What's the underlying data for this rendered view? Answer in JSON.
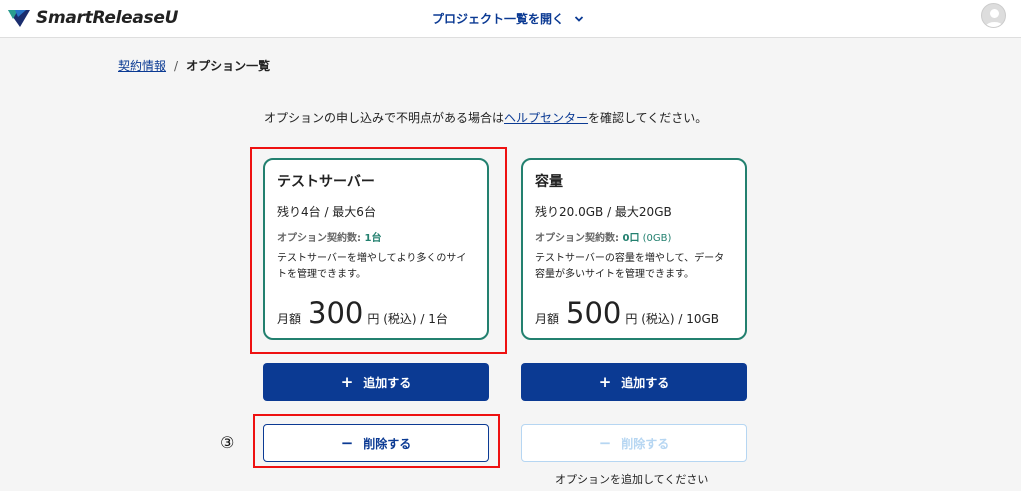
{
  "header": {
    "logo_text": "SmartReleaseU",
    "project_menu": "プロジェクト一覧を開く"
  },
  "breadcrumb": {
    "parent": "契約情報",
    "separator": "/",
    "current": "オプション一覧"
  },
  "notice": {
    "before": "オプションの申し込みで不明点がある場合は",
    "link": "ヘルプセンター",
    "after": "を確認してください。"
  },
  "cards": [
    {
      "title": "テストサーバー",
      "remain": "残り4台 / 最大6台",
      "contract_label": "オプション契約数: ",
      "contract_count": "1台",
      "contract_extra": "",
      "description": "テストサーバーを増やしてより多くのサイトを管理できます。",
      "price_prefix": "月額",
      "price_amount": "300",
      "price_suffix": "円 (税込) / 1台",
      "add_label": "追加する",
      "delete_label": "削除する"
    },
    {
      "title": "容量",
      "remain": "残り20.0GB / 最大20GB",
      "contract_label": "オプション契約数: ",
      "contract_count": "0口",
      "contract_extra": " (0GB)",
      "description": "テストサーバーの容量を増やして、データ容量が多いサイトを管理できます。",
      "price_prefix": "月額",
      "price_amount": "500",
      "price_suffix": "円 (税込) / 10GB",
      "add_label": "追加する",
      "delete_label": "削除する"
    }
  ],
  "step_marker": "③",
  "hint": "オプションを追加してください",
  "colors": {
    "accent": "#0b3a93",
    "card_border": "#23806f",
    "highlight": "#ee1111",
    "disabled": "#b6d6f2"
  },
  "icons": {
    "add": "plus-icon",
    "delete": "minus-icon",
    "project_menu": "chevron-down-icon"
  }
}
